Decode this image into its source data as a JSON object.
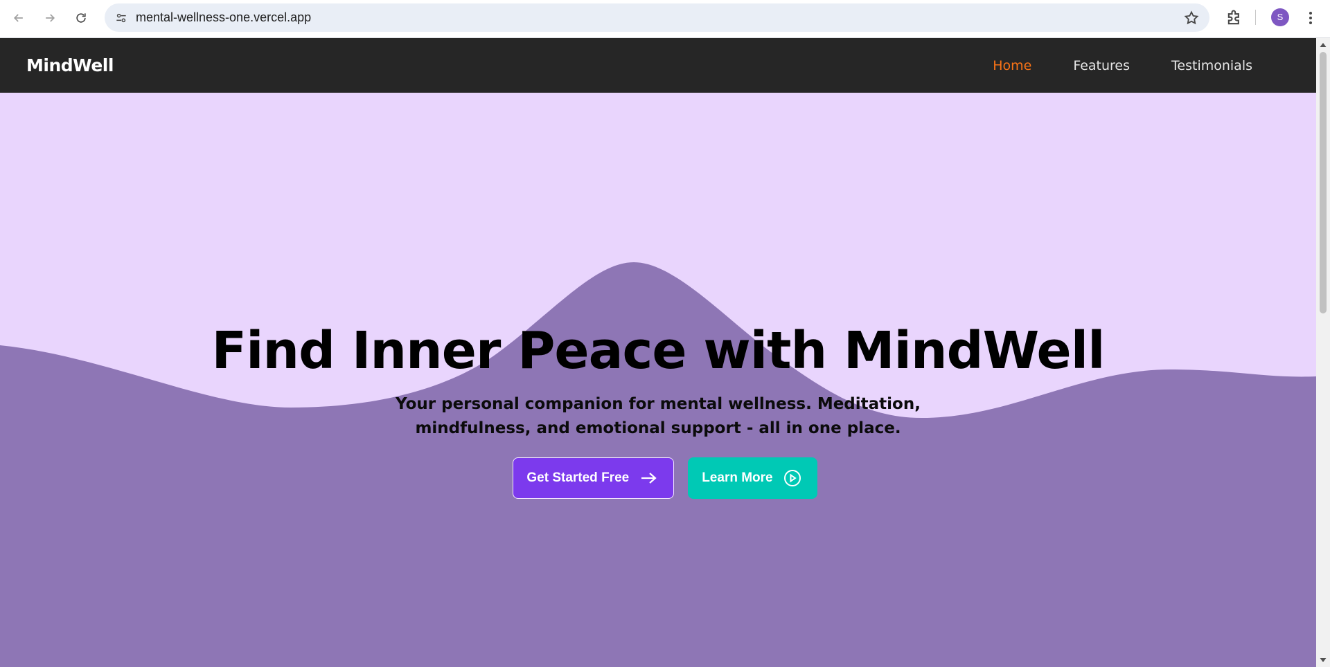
{
  "browser": {
    "url": "mental-wellness-one.vercel.app",
    "profile_initial": "S",
    "icons": {
      "back": "arrow-left-icon",
      "forward": "arrow-right-icon",
      "reload": "reload-icon",
      "site_info": "tune-icon",
      "bookmark": "star-icon",
      "extensions": "puzzle-icon",
      "menu": "more-vertical-icon"
    }
  },
  "site": {
    "brand": "MindWell",
    "nav": [
      {
        "label": "Home",
        "active": true
      },
      {
        "label": "Features",
        "active": false
      },
      {
        "label": "Testimonials",
        "active": false
      }
    ]
  },
  "hero": {
    "headline": "Find Inner Peace with MindWell",
    "subheadline": "Your personal companion for mental wellness. Meditation, mindfulness, and emotional support - all in one place.",
    "primary_cta": "Get Started Free",
    "secondary_cta": "Learn More"
  },
  "colors": {
    "navbar_bg": "#262626",
    "nav_active": "#f97316",
    "hero_bg": "#e9d5fd",
    "wave": "#8e76b5",
    "primary_button": "#7c3aed",
    "secondary_button": "#00c9b5"
  }
}
